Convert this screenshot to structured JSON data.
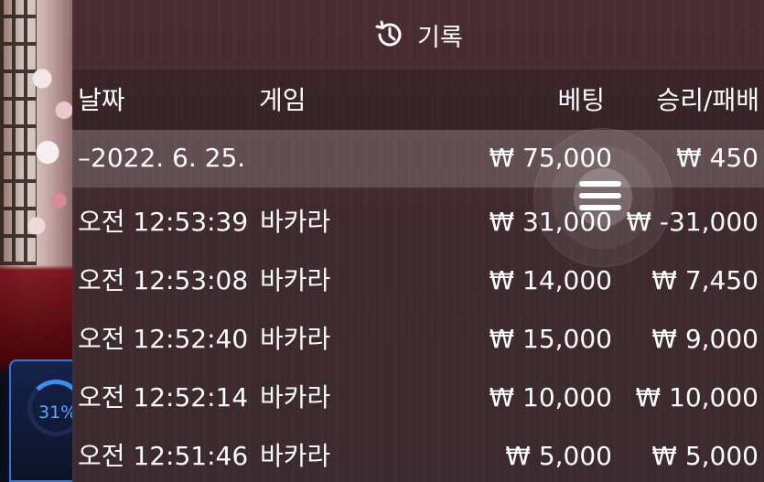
{
  "background": {
    "progress_text": "31%",
    "progress_value": 0.31,
    "accent_color": "#2f78d6"
  },
  "panel": {
    "title": "기록",
    "title_icon": "history-icon",
    "columns": {
      "date": "날짜",
      "game": "게임",
      "bet": "베팅",
      "result": "승리/패배"
    },
    "date_group": {
      "date": "–2022. 6. 25.",
      "bet_total": "₩ 75,000",
      "result_total": "₩ 450"
    },
    "rows": [
      {
        "time": "오전 12:53:39",
        "game": "바카라",
        "bet": "₩ 31,000",
        "result": "₩ -31,000"
      },
      {
        "time": "오전 12:53:08",
        "game": "바카라",
        "bet": "₩ 14,000",
        "result": "₩ 7,450"
      },
      {
        "time": "오전 12:52:40",
        "game": "바카라",
        "bet": "₩ 15,000",
        "result": "₩ 9,000"
      },
      {
        "time": "오전 12:52:14",
        "game": "바카라",
        "bet": "₩ 10,000",
        "result": "₩ 10,000"
      },
      {
        "time": "오전 12:51:46",
        "game": "바카라",
        "bet": "₩ 5,000",
        "result": "₩ 5,000"
      }
    ],
    "menu_icon": "menu-icon"
  }
}
